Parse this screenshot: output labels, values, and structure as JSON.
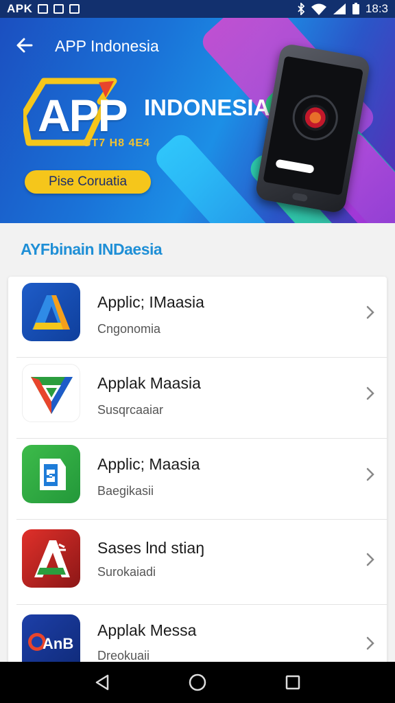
{
  "status_bar": {
    "carrier": "APK",
    "time": "18:3"
  },
  "header": {
    "title": "APP Indonesia"
  },
  "hero": {
    "logo_letters": "APP",
    "logo_word": "INDONESIA",
    "logo_subtext": "GT7 H8 4E4",
    "button_label": "Pise Coruatia"
  },
  "section": {
    "title": "AYFbinain INDaesia"
  },
  "apps": [
    {
      "name": "Applic; IMaasia",
      "subtitle": "Cngonomia",
      "icon": "blue-a-icon"
    },
    {
      "name": "Applak Maasia",
      "subtitle": "Susqrcaaiar",
      "icon": "tri-color-v-icon"
    },
    {
      "name": "Applic; Maasia",
      "subtitle": "Baegikasii",
      "icon": "green-store-icon"
    },
    {
      "name": "Sases lnd stiaŋ",
      "subtitle": "Surokaiadi",
      "icon": "red-a-icon"
    },
    {
      "name": "Applak Messa",
      "subtitle": "Dreokuaii",
      "icon": "blue-anb-icon"
    }
  ],
  "app_icon_text": {
    "blue_a": "A",
    "red_a": "A",
    "blue_anb": "AnB"
  }
}
